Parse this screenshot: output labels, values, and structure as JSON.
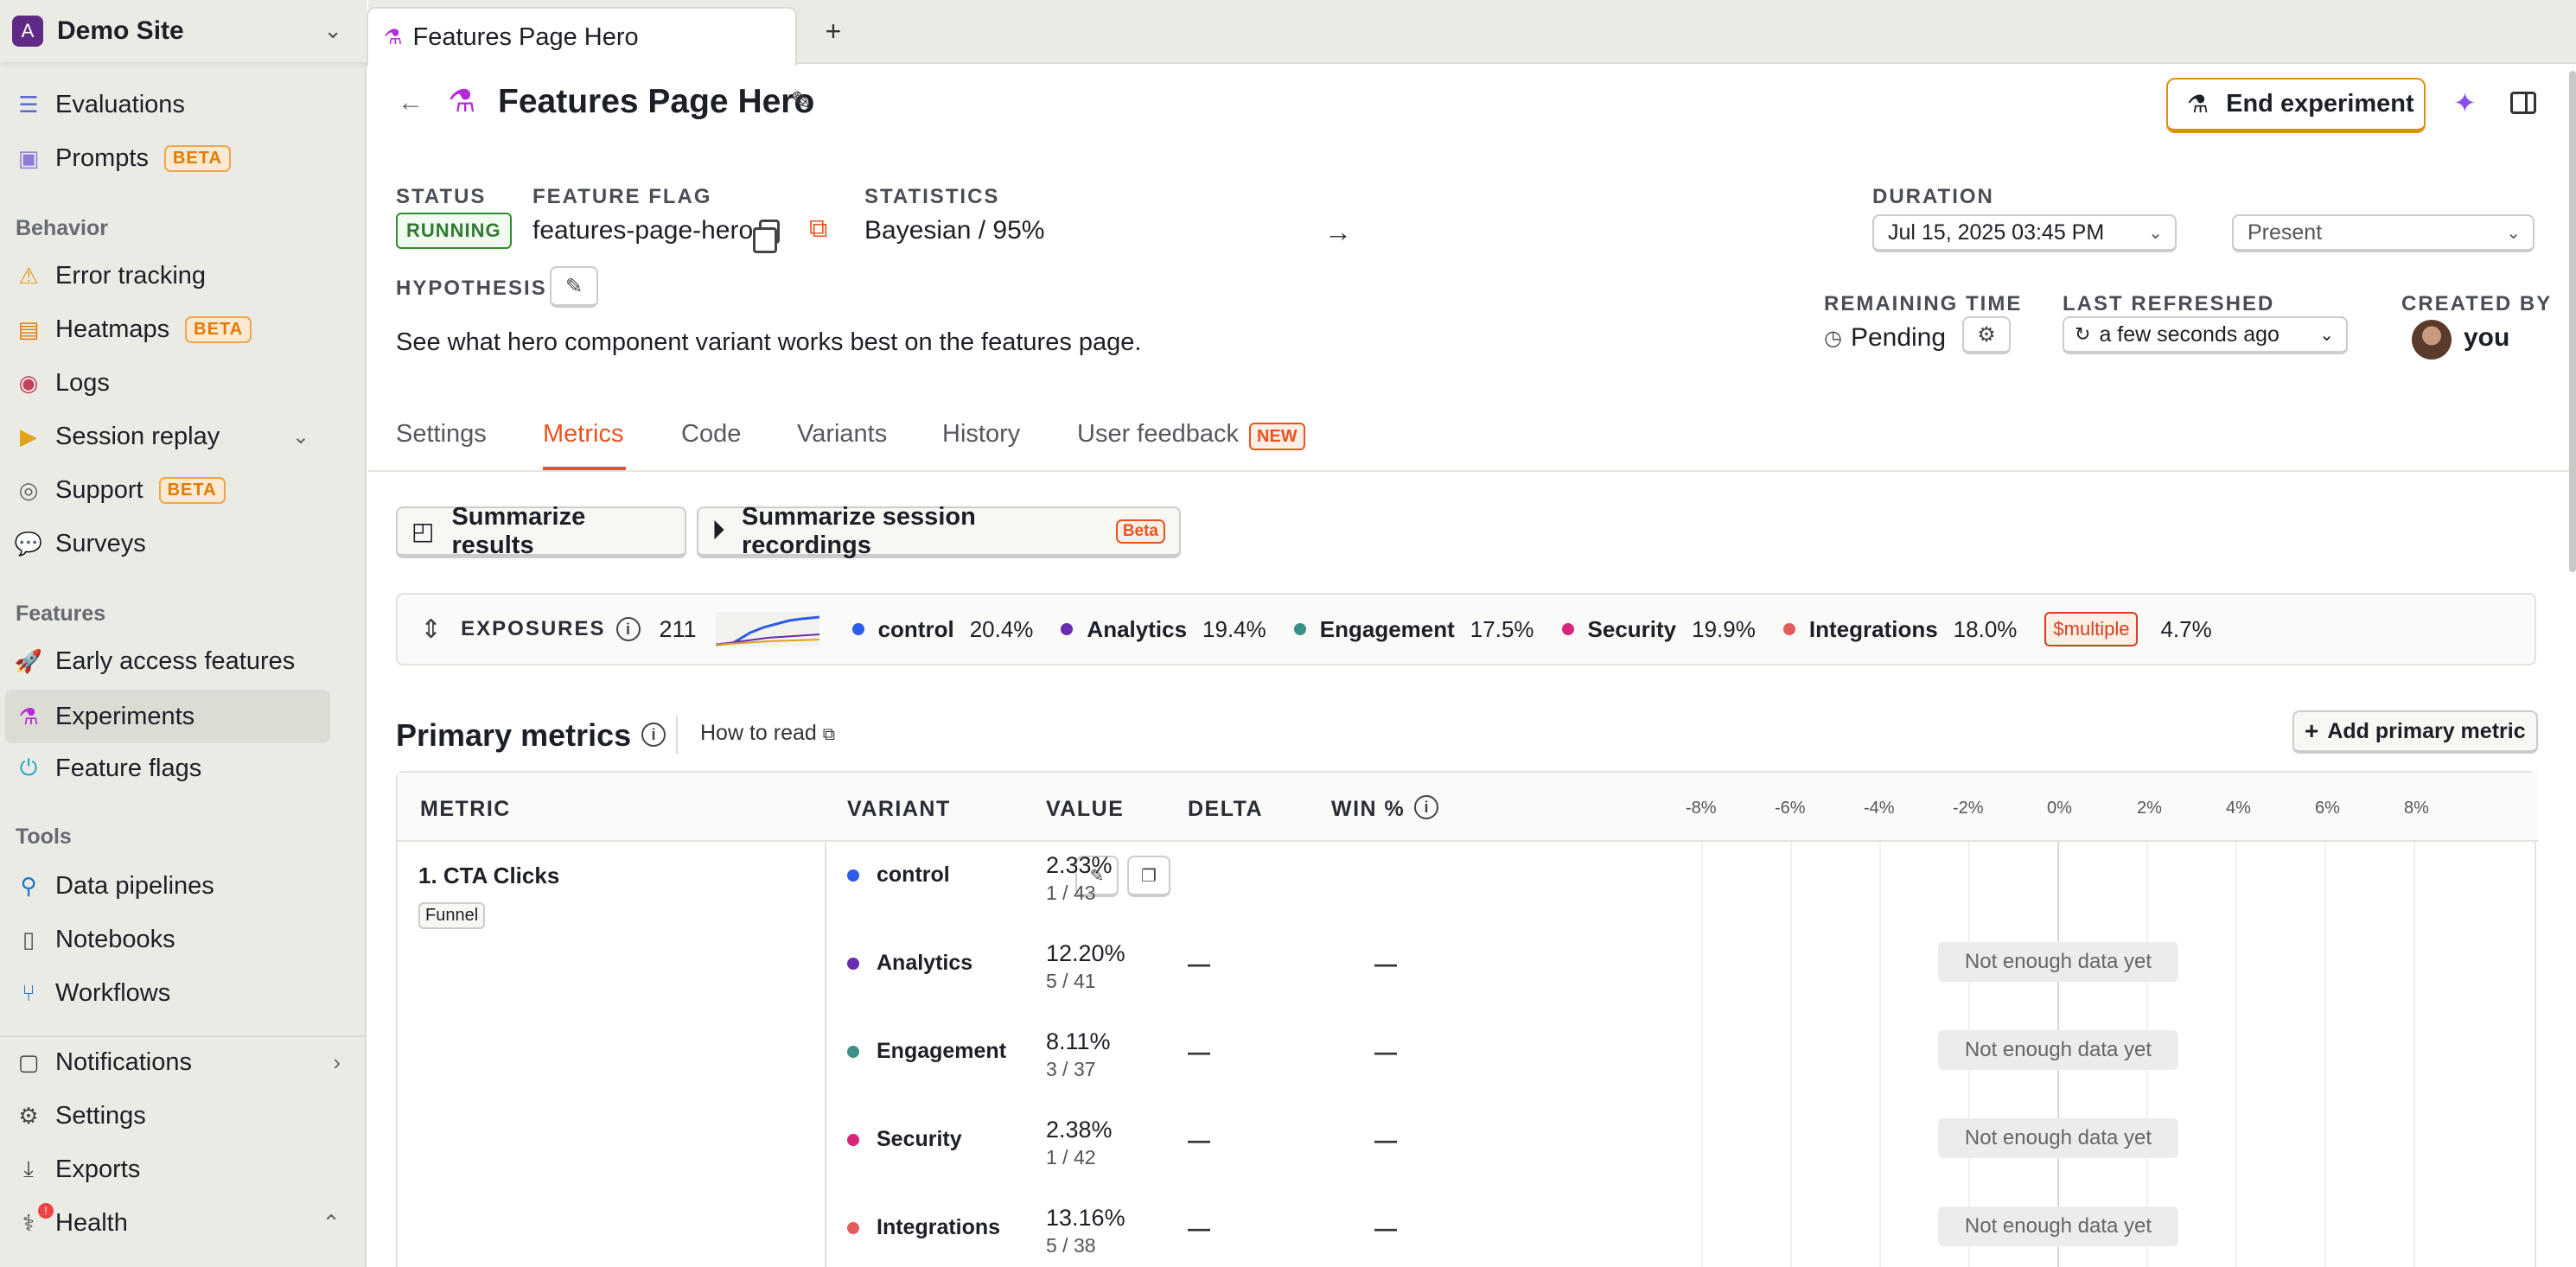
{
  "site": {
    "initial": "A",
    "name": "Demo Site"
  },
  "sidebar": {
    "items_top": [
      {
        "label": "Evaluations",
        "icon": "list-check-icon"
      },
      {
        "label": "Prompts",
        "icon": "prompt-icon",
        "badge": "BETA"
      }
    ],
    "behavior_label": "Behavior",
    "behavior": [
      {
        "label": "Error tracking",
        "icon": "warning-icon"
      },
      {
        "label": "Heatmaps",
        "icon": "heatmap-icon",
        "badge": "BETA"
      },
      {
        "label": "Logs",
        "icon": "broadcast-icon"
      },
      {
        "label": "Session replay",
        "icon": "replay-icon"
      },
      {
        "label": "Support",
        "icon": "lifebuoy-icon",
        "badge": "BETA"
      },
      {
        "label": "Surveys",
        "icon": "chat-icon"
      }
    ],
    "features_label": "Features",
    "features": [
      {
        "label": "Early access features",
        "icon": "rocket-icon"
      },
      {
        "label": "Experiments",
        "icon": "flask-icon"
      },
      {
        "label": "Feature flags",
        "icon": "toggle-icon"
      }
    ],
    "tools_label": "Tools",
    "tools": [
      {
        "label": "Data pipelines",
        "icon": "pipeline-icon"
      },
      {
        "label": "Notebooks",
        "icon": "notebook-icon"
      },
      {
        "label": "Workflows",
        "icon": "workflow-icon"
      }
    ],
    "bottom": [
      {
        "label": "Notifications",
        "icon": "notification-icon"
      },
      {
        "label": "Settings",
        "icon": "gear-icon"
      },
      {
        "label": "Exports",
        "icon": "download-icon"
      },
      {
        "label": "Health",
        "icon": "stethoscope-icon",
        "alert": "!"
      }
    ]
  },
  "tabbar": {
    "tab_title": "Features Page Hero",
    "new_tab": "+"
  },
  "header": {
    "title": "Features Page Hero",
    "end_button": "End experiment"
  },
  "meta": {
    "status_label": "STATUS",
    "status_value": "RUNNING",
    "flag_label": "FEATURE FLAG",
    "flag_value": "features-page-hero",
    "stats_label": "STATISTICS",
    "stats_value": "Bayesian / 95%",
    "duration_label": "DURATION",
    "duration_start": "Jul 15, 2025 03:45 PM",
    "duration_end": "Present",
    "hypothesis_label": "HYPOTHESIS",
    "hypothesis": "See what hero component variant works best on the features page.",
    "remaining_label": "REMAINING TIME",
    "remaining_value": "Pending",
    "refreshed_label": "LAST REFRESHED",
    "refreshed_value": "a few seconds ago",
    "created_label": "CREATED BY",
    "created_value": "you"
  },
  "tabs": [
    {
      "label": "Settings"
    },
    {
      "label": "Metrics"
    },
    {
      "label": "Code"
    },
    {
      "label": "Variants"
    },
    {
      "label": "History"
    },
    {
      "label": "User feedback",
      "badge": "NEW"
    }
  ],
  "actions": {
    "summarize_results": "Summarize results",
    "summarize_recordings": "Summarize session recordings",
    "beta": "Beta"
  },
  "exposures": {
    "label": "EXPOSURES",
    "total": "211",
    "variants": [
      {
        "name": "control",
        "pct": "20.4%",
        "color": "#2f5bea"
      },
      {
        "name": "Analytics",
        "pct": "19.4%",
        "color": "#6a2bb0"
      },
      {
        "name": "Engagement",
        "pct": "17.5%",
        "color": "#3a8f86"
      },
      {
        "name": "Security",
        "pct": "19.9%",
        "color": "#d6257a"
      },
      {
        "name": "Integrations",
        "pct": "18.0%",
        "color": "#e45b5b"
      }
    ],
    "multiple_label": "$multiple",
    "multiple_pct": "4.7%"
  },
  "primary_metrics": {
    "title": "Primary metrics",
    "how_to_read": "How to read",
    "add_button": "Add primary metric",
    "columns": {
      "metric": "METRIC",
      "variant": "VARIANT",
      "value": "VALUE",
      "delta": "DELTA",
      "win": "WIN %"
    },
    "scale": [
      "-8%",
      "-6%",
      "-4%",
      "-2%",
      "0%",
      "2%",
      "4%",
      "6%",
      "8%"
    ],
    "metric": {
      "name": "1. CTA Clicks",
      "tag": "Funnel"
    },
    "rows": [
      {
        "variant": "control",
        "color": "#2f5bea",
        "value": "2.33%",
        "count": "1 / 43",
        "delta": "",
        "win": "",
        "note": ""
      },
      {
        "variant": "Analytics",
        "color": "#6a2bb0",
        "value": "12.20%",
        "count": "5 / 41",
        "delta": "—",
        "win": "—",
        "note": "Not enough data yet"
      },
      {
        "variant": "Engagement",
        "color": "#3a8f86",
        "value": "8.11%",
        "count": "3 / 37",
        "delta": "—",
        "win": "—",
        "note": "Not enough data yet"
      },
      {
        "variant": "Security",
        "color": "#d6257a",
        "value": "2.38%",
        "count": "1 / 42",
        "delta": "—",
        "win": "—",
        "note": "Not enough data yet"
      },
      {
        "variant": "Integrations",
        "color": "#e45b5b",
        "value": "13.16%",
        "count": "5 / 38",
        "delta": "—",
        "win": "—",
        "note": "Not enough data yet"
      }
    ]
  }
}
